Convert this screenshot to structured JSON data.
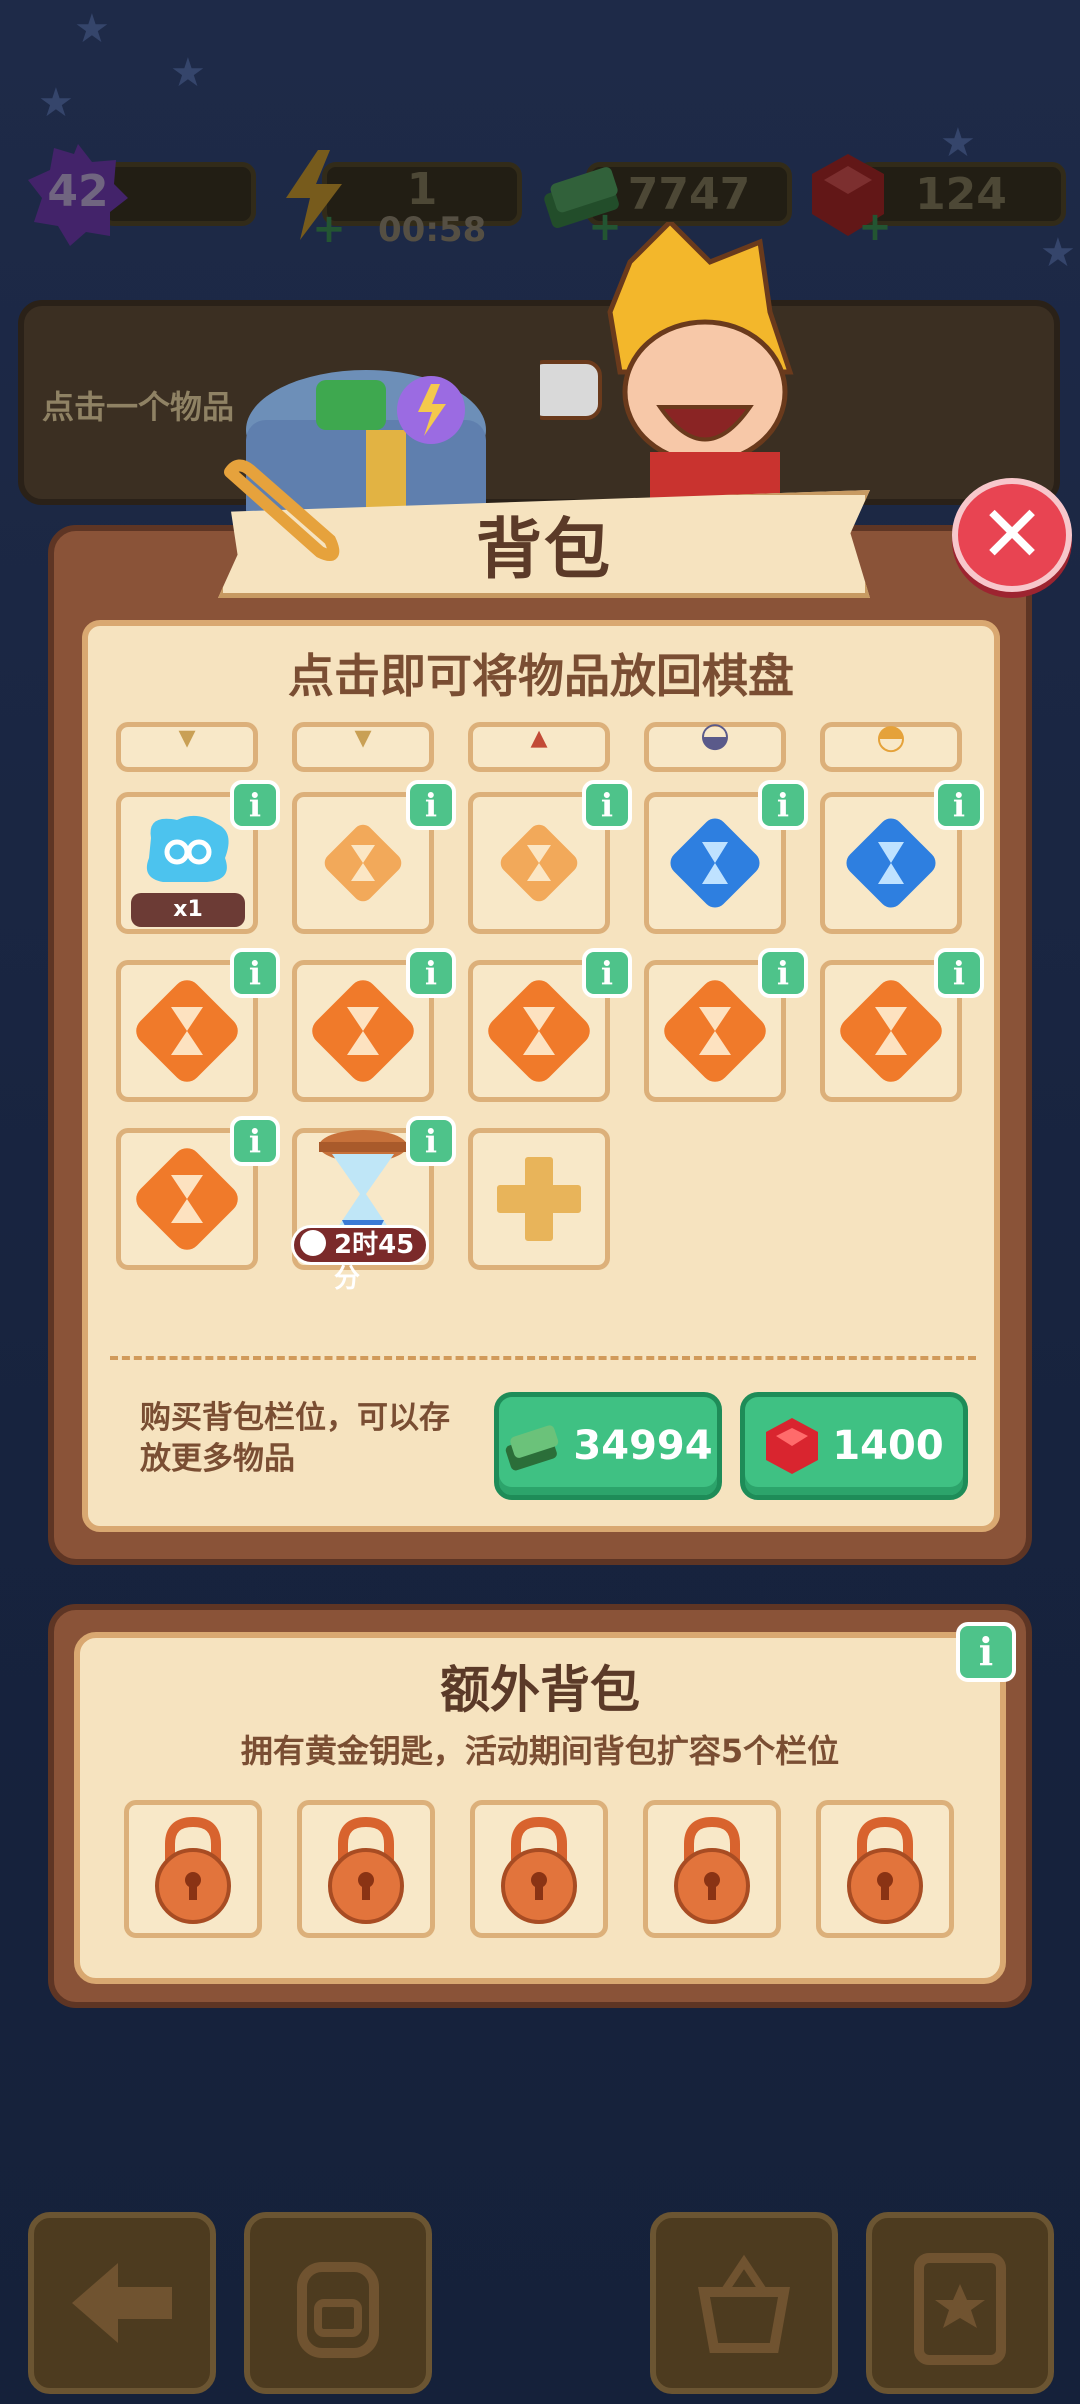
{
  "hud": {
    "level": "42",
    "energy": "1",
    "energy_timer": "00:58",
    "cash": "7747",
    "gems": "124"
  },
  "info_banner": {
    "text": "点击一个物品"
  },
  "backpack": {
    "title": "背包",
    "subtitle": "点击即可将物品放回棋盘",
    "slots": [
      {
        "icon": "scissors-pack-icon",
        "badge": "x1"
      },
      {
        "icon": "orange-hourglass-small-icon"
      },
      {
        "icon": "orange-hourglass-small-icon"
      },
      {
        "icon": "blue-hourglass-icon"
      },
      {
        "icon": "blue-hourglass-icon"
      },
      {
        "icon": "orange-hourglass-large-icon"
      },
      {
        "icon": "orange-hourglass-large-icon"
      },
      {
        "icon": "orange-hourglass-large-icon"
      },
      {
        "icon": "orange-hourglass-large-icon"
      },
      {
        "icon": "orange-hourglass-large-icon"
      },
      {
        "icon": "orange-hourglass-large-icon"
      },
      {
        "icon": "golden-hourglass-icon",
        "timer": "2时45分"
      },
      {
        "icon": "add-slot-plus-icon"
      }
    ],
    "buy_text": "购买背包栏位，可以存放更多物品",
    "buy_cash_price": "34994",
    "buy_gem_price": "1400"
  },
  "extra_backpack": {
    "title": "额外背包",
    "subtitle": "拥有黄金钥匙，活动期间背包扩容5个栏位",
    "locked_slots": 5
  },
  "colors": {
    "accent_green": "#3fc183",
    "panel_brown": "#8a5338",
    "panel_cream": "#f6e3bf",
    "close_red": "#e84452"
  }
}
